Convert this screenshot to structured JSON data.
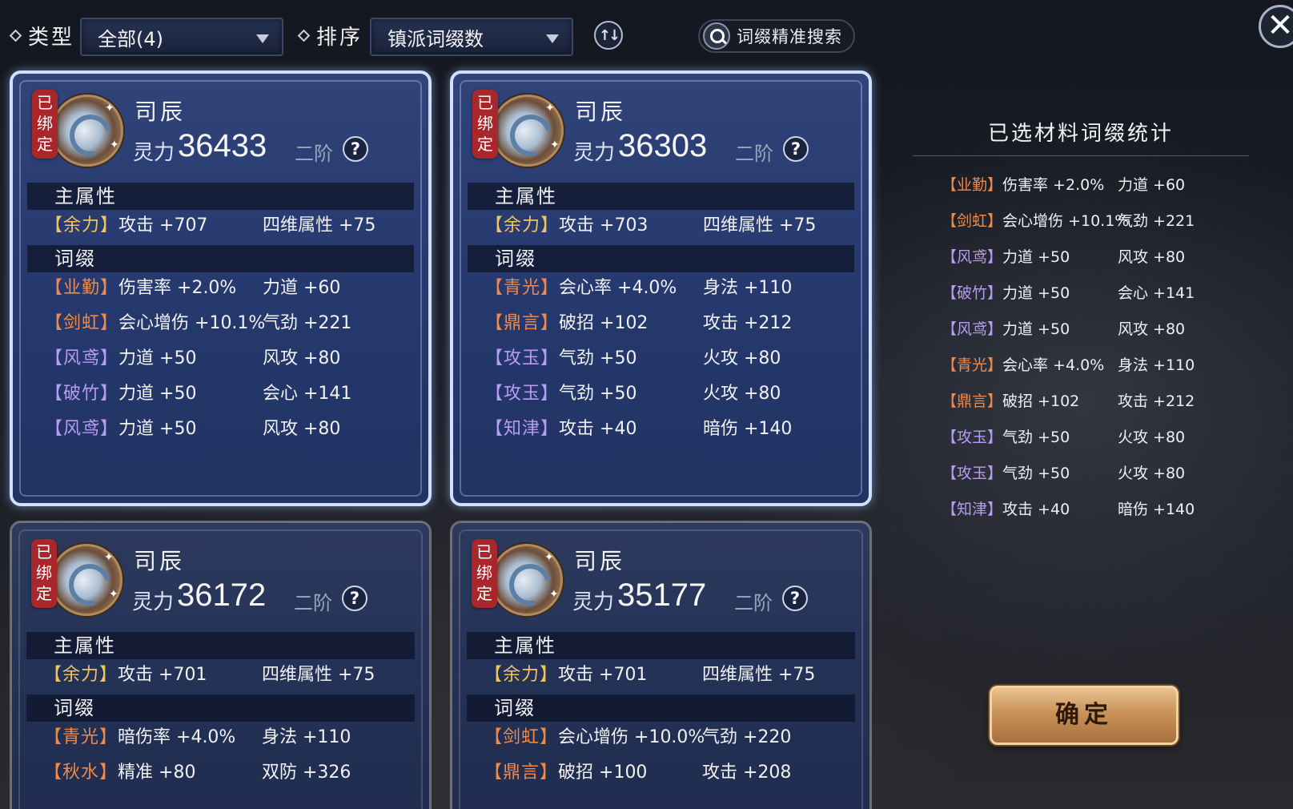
{
  "filters": {
    "type_label": "类型",
    "type_value": "全部(4)",
    "sort_label": "排序",
    "sort_value": "镇派词缀数",
    "search_label": "词缀精准搜索"
  },
  "common": {
    "bound_label": "已绑定",
    "power_label": "灵力",
    "tier": "二阶",
    "help": "?",
    "main_attr_header": "主属性",
    "affix_header": "词缀"
  },
  "cards": [
    {
      "name": "司辰",
      "power": "36433",
      "selected": true,
      "main_attr": {
        "tag": "【余力】",
        "a": "攻击 +707",
        "b": "四维属性 +75"
      },
      "affixes": [
        {
          "tag": "【业勤】",
          "color": "orange",
          "a": "伤害率 +2.0%",
          "b": "力道 +60"
        },
        {
          "tag": "【剑虹】",
          "color": "orange",
          "a": "会心增伤 +10.1%",
          "b": "气劲 +221"
        },
        {
          "tag": "【风鸢】",
          "color": "purple",
          "a": "力道 +50",
          "b": "风攻 +80"
        },
        {
          "tag": "【破竹】",
          "color": "purple",
          "a": "力道 +50",
          "b": "会心 +141"
        },
        {
          "tag": "【风鸢】",
          "color": "purple",
          "a": "力道 +50",
          "b": "风攻 +80"
        }
      ]
    },
    {
      "name": "司辰",
      "power": "36303",
      "selected": true,
      "main_attr": {
        "tag": "【余力】",
        "a": "攻击 +703",
        "b": "四维属性 +75"
      },
      "affixes": [
        {
          "tag": "【青光】",
          "color": "orange",
          "a": "会心率 +4.0%",
          "b": "身法 +110"
        },
        {
          "tag": "【鼎言】",
          "color": "orange",
          "a": "破招 +102",
          "b": "攻击 +212"
        },
        {
          "tag": "【攻玉】",
          "color": "purple",
          "a": "气劲 +50",
          "b": "火攻 +80"
        },
        {
          "tag": "【攻玉】",
          "color": "purple",
          "a": "气劲 +50",
          "b": "火攻 +80"
        },
        {
          "tag": "【知津】",
          "color": "purple",
          "a": "攻击 +40",
          "b": "暗伤 +140"
        }
      ]
    },
    {
      "name": "司辰",
      "power": "36172",
      "selected": false,
      "main_attr": {
        "tag": "【余力】",
        "a": "攻击 +701",
        "b": "四维属性 +75"
      },
      "affixes": [
        {
          "tag": "【青光】",
          "color": "orange",
          "a": "暗伤率 +4.0%",
          "b": "身法 +110"
        },
        {
          "tag": "【秋水】",
          "color": "orange",
          "a": "精准 +80",
          "b": "双防 +326"
        }
      ]
    },
    {
      "name": "司辰",
      "power": "35177",
      "selected": false,
      "main_attr": {
        "tag": "【余力】",
        "a": "攻击 +701",
        "b": "四维属性 +75"
      },
      "affixes": [
        {
          "tag": "【剑虹】",
          "color": "orange",
          "a": "会心增伤 +10.0%",
          "b": "气劲 +220"
        },
        {
          "tag": "【鼎言】",
          "color": "orange",
          "a": "破招 +100",
          "b": "攻击 +208"
        }
      ]
    }
  ],
  "stats": {
    "title": "已选材料词缀统计",
    "rows": [
      {
        "tag": "【业勤】",
        "color": "orange",
        "a": "伤害率 +2.0%",
        "b": "力道 +60"
      },
      {
        "tag": "【剑虹】",
        "color": "orange",
        "a": "会心增伤 +10.1%",
        "b": "气劲 +221"
      },
      {
        "tag": "【风鸢】",
        "color": "purple",
        "a": "力道 +50",
        "b": "风攻 +80"
      },
      {
        "tag": "【破竹】",
        "color": "purple",
        "a": "力道 +50",
        "b": "会心 +141"
      },
      {
        "tag": "【风鸢】",
        "color": "purple",
        "a": "力道 +50",
        "b": "风攻 +80"
      },
      {
        "tag": "【青光】",
        "color": "orange",
        "a": "会心率 +4.0%",
        "b": "身法 +110"
      },
      {
        "tag": "【鼎言】",
        "color": "orange",
        "a": "破招 +102",
        "b": "攻击 +212"
      },
      {
        "tag": "【攻玉】",
        "color": "purple",
        "a": "气劲 +50",
        "b": "火攻 +80"
      },
      {
        "tag": "【攻玉】",
        "color": "purple",
        "a": "气劲 +50",
        "b": "火攻 +80"
      },
      {
        "tag": "【知津】",
        "color": "purple",
        "a": "攻击 +40",
        "b": "暗伤 +140"
      }
    ]
  },
  "confirm_label": "确定",
  "icons": {
    "close": "close-icon",
    "search": "search-icon",
    "sort": "sort-order-icon",
    "emblem": "wave-emblem-icon"
  },
  "colors": {
    "orange_affix": "#ef8a4a",
    "purple_affix": "#b79cf1",
    "gold_affix": "#f3c45a",
    "bound_tag": "#a9272a"
  }
}
